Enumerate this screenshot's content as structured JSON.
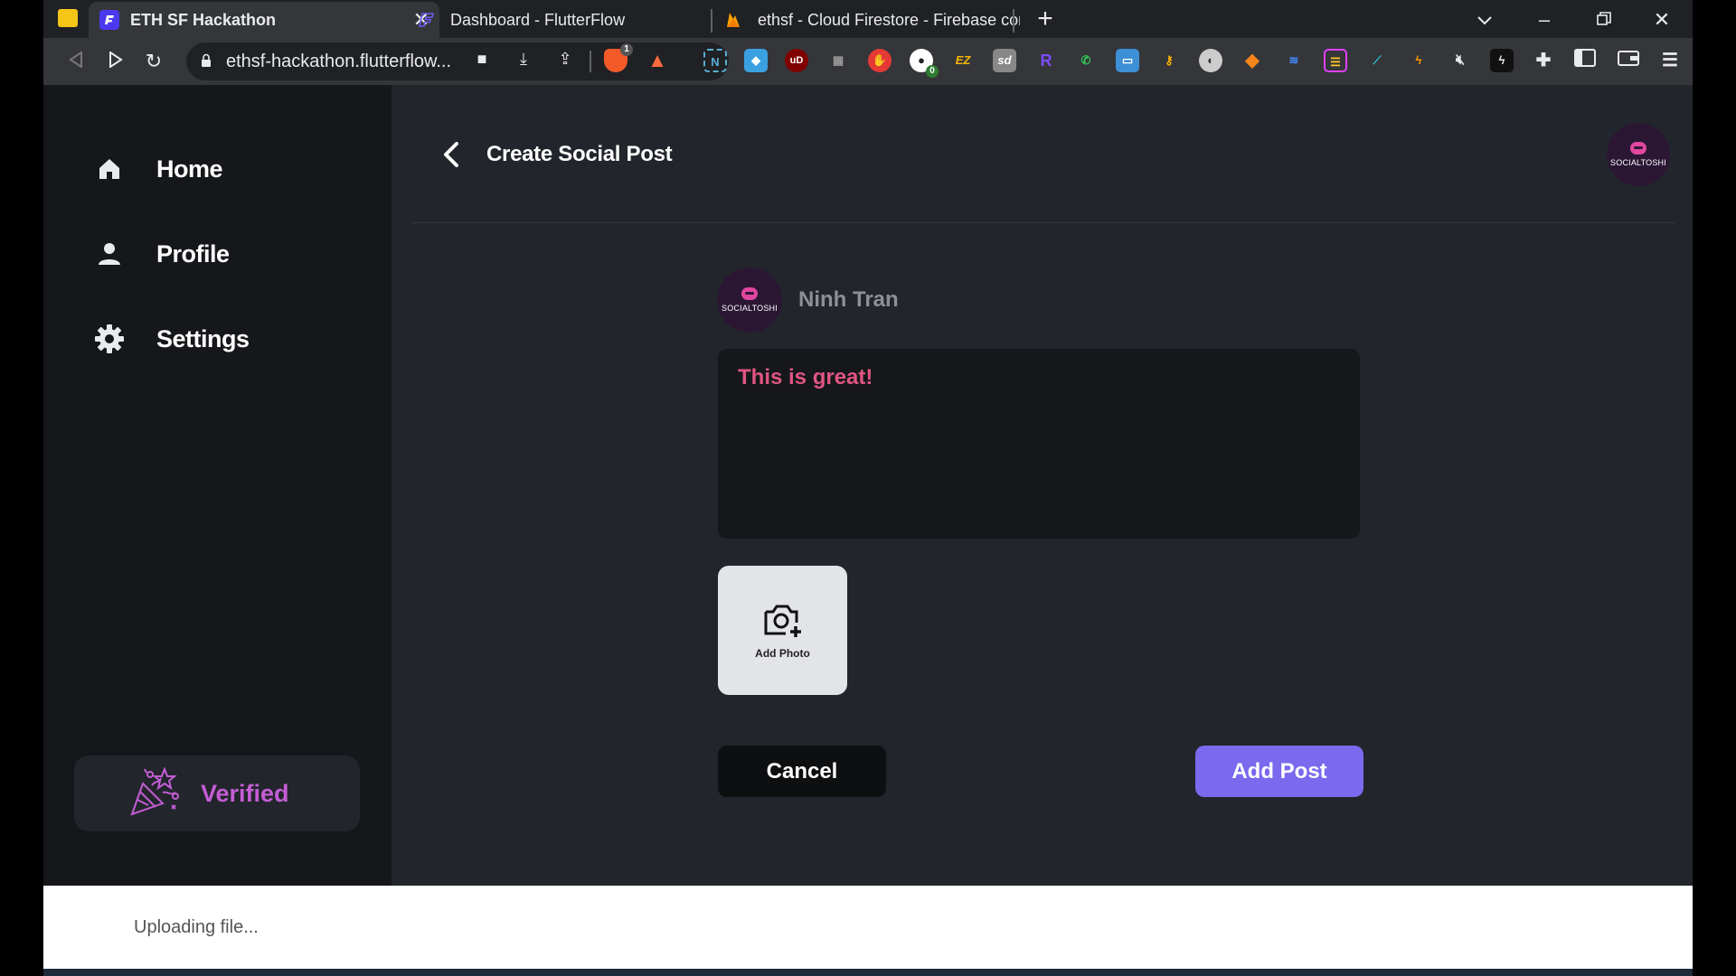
{
  "browser": {
    "tabs": [
      {
        "title": "ETH SF Hackathon",
        "icon": "flutterflow-icon",
        "active": true
      },
      {
        "title": "Dashboard - FlutterFlow",
        "icon": "flutterflow-icon",
        "active": false
      },
      {
        "title": "ethsf - Cloud Firestore - Firebase cons",
        "icon": "firebase-icon",
        "active": false
      }
    ],
    "url": "ethsf-hackathon.flutterflow...",
    "brave_shield_count": "1",
    "extension_badge": "0"
  },
  "sidebar": {
    "items": [
      {
        "label": "Home",
        "icon": "home-icon"
      },
      {
        "label": "Profile",
        "icon": "person-icon"
      },
      {
        "label": "Settings",
        "icon": "gear-icon"
      }
    ],
    "verified_label": "Verified"
  },
  "header": {
    "title": "Create Social Post",
    "brand": "SOCIALTOSHI"
  },
  "post": {
    "user_name": "Ninh Tran",
    "avatar_brand": "SOCIALTOSHI",
    "text": "This is great!",
    "add_photo_label": "Add Photo",
    "cancel_label": "Cancel",
    "submit_label": "Add Post"
  },
  "snackbar": {
    "message": "Uploading file..."
  },
  "colors": {
    "accent": "#7b69ee",
    "verified": "#c45dd5",
    "post_text": "#e05582",
    "brand_pink": "#e0479e"
  }
}
